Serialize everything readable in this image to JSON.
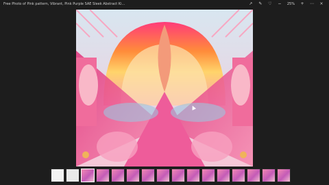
{
  "window": {
    "title": "Free Photo of Pink pattern, Vibrant, Pink Purple SAE Sleek Abstract Kindle Home Decoration, Boho..."
  },
  "toolbar": {
    "zoom_label": "25%",
    "icons": [
      "share-icon",
      "edit-icon",
      "heart-icon",
      "zoom-out-icon",
      "zoom-in-icon",
      "more-icon",
      "close-icon"
    ]
  },
  "filmstrip": {
    "count": 16,
    "active_index": 2
  }
}
